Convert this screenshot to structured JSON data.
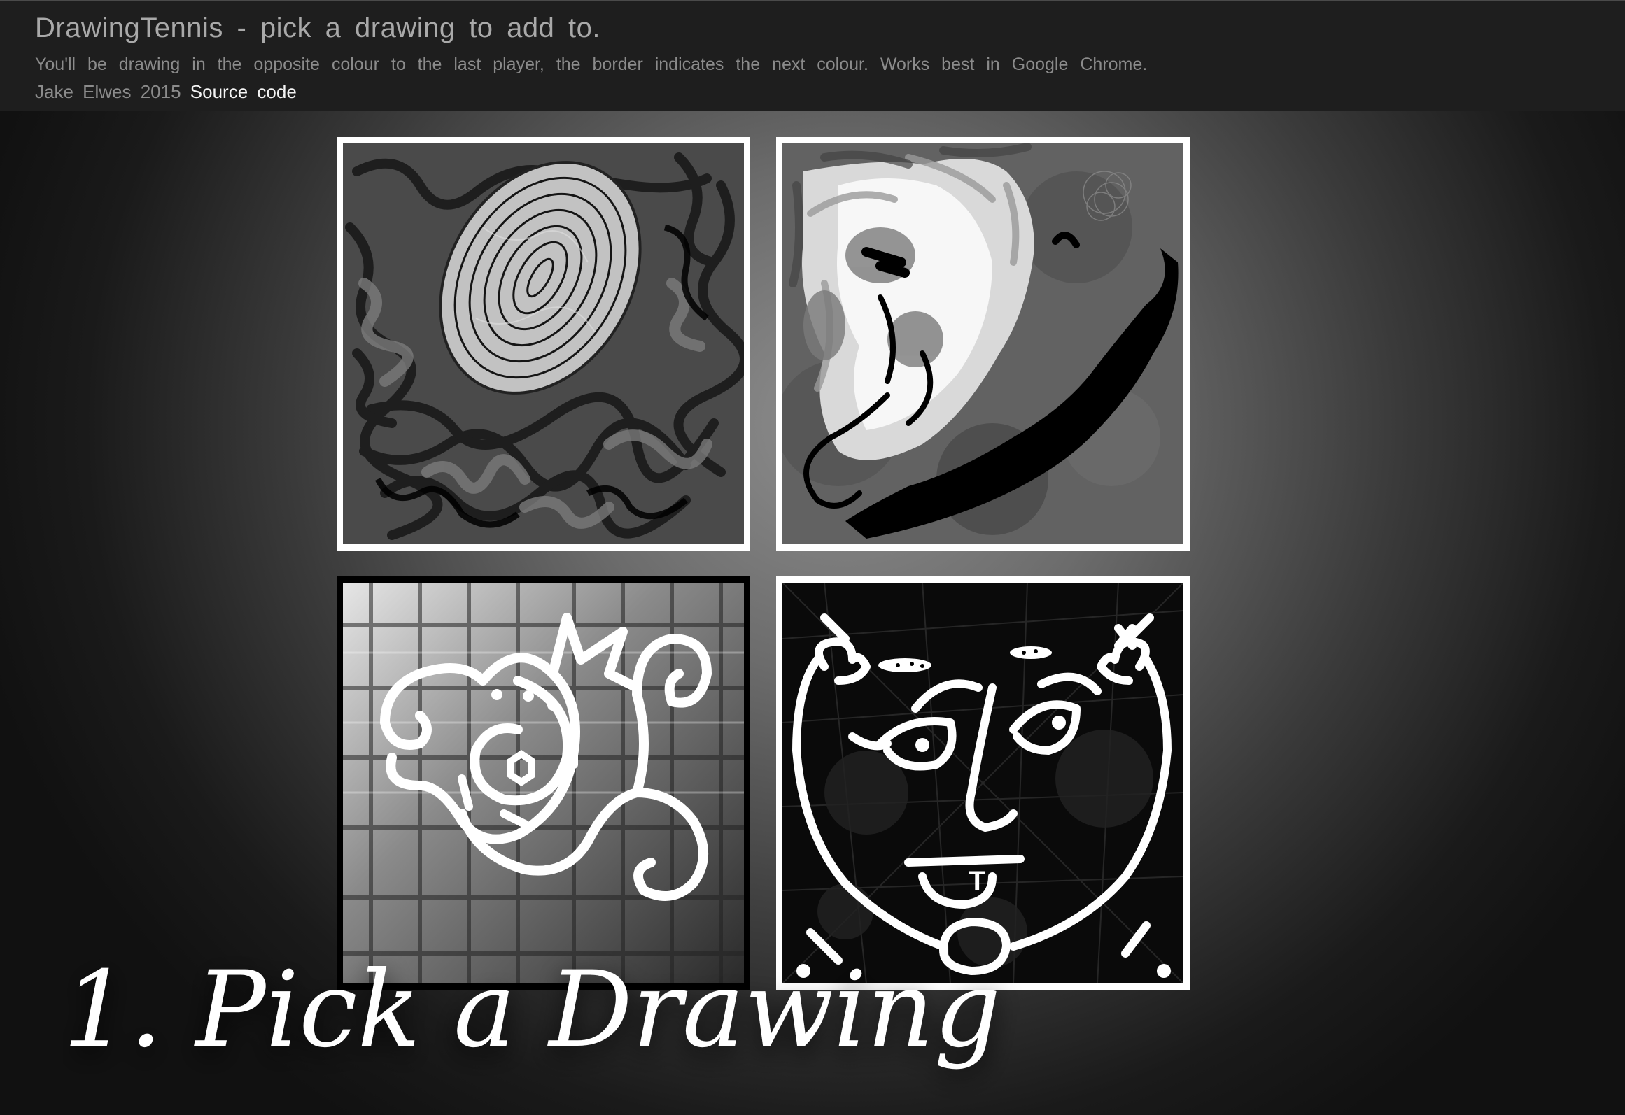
{
  "header": {
    "title": "DrawingTennis - pick a drawing to add to.",
    "subtitle": "You'll be drawing in the opposite colour to the last player, the border indicates the next colour. Works best in Google Chrome.",
    "author": "Jake Elwes 2015",
    "source_link_label": "Source code"
  },
  "drawings": [
    {
      "next_colour": "white",
      "border": "#ffffff"
    },
    {
      "next_colour": "white",
      "border": "#ffffff"
    },
    {
      "next_colour": "black",
      "border": "#000000"
    },
    {
      "next_colour": "white",
      "border": "#ffffff"
    }
  ],
  "caption": "1. Pick a Drawing",
  "colors": {
    "header_bg": "#1e1e1e",
    "title_text": "#a9a9a9",
    "subtitle_text": "#8b8b8b",
    "link_text": "#f4f4f4"
  }
}
